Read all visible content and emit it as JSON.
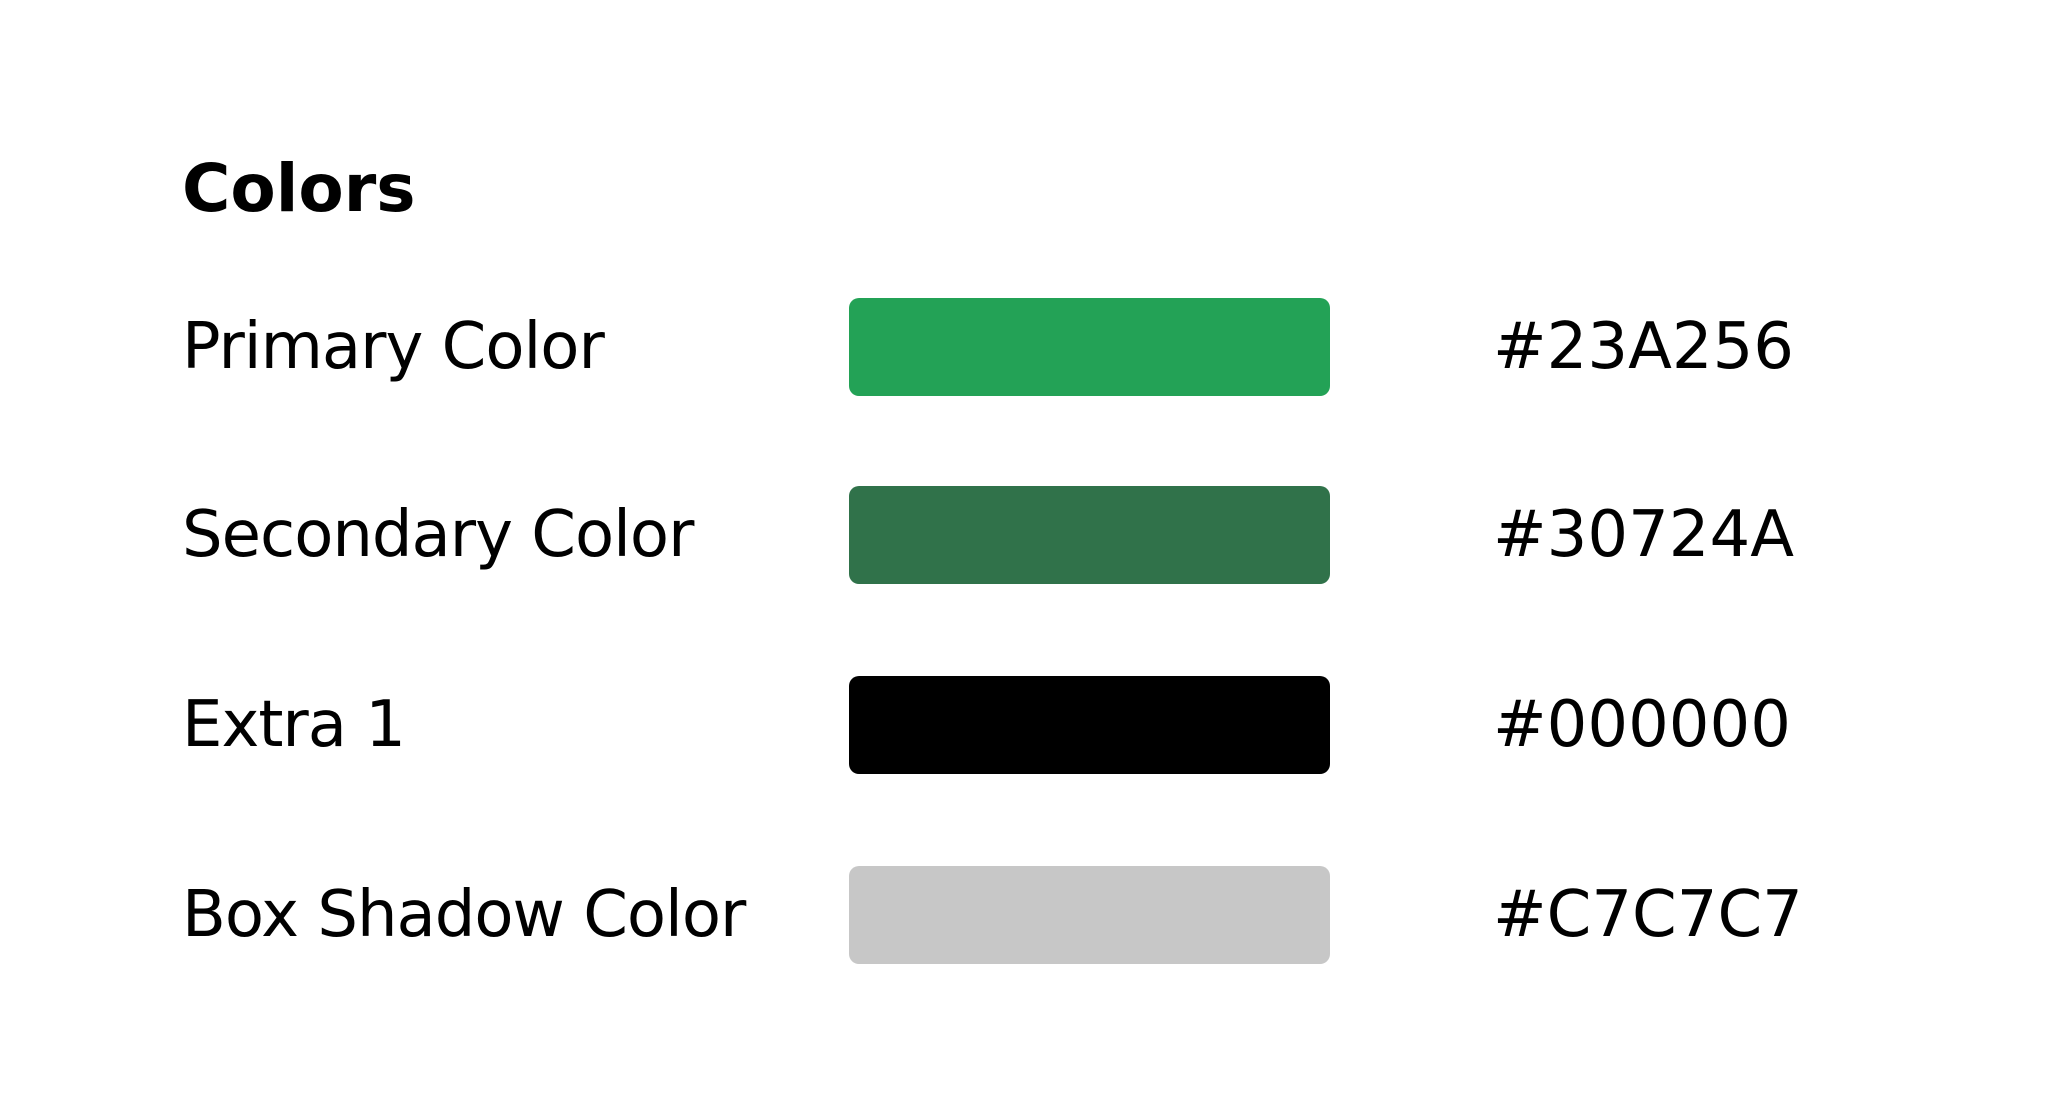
{
  "section": {
    "title": "Colors"
  },
  "swatches": [
    {
      "label": "Primary Color",
      "hex": "#23A256",
      "color": "#23A256"
    },
    {
      "label": "Secondary Color",
      "hex": "#30724A",
      "color": "#30724A"
    },
    {
      "label": "Extra 1",
      "hex": "#000000",
      "color": "#000000"
    },
    {
      "label": "Box Shadow Color",
      "hex": "#C7C7C7",
      "color": "#C7C7C7"
    }
  ]
}
